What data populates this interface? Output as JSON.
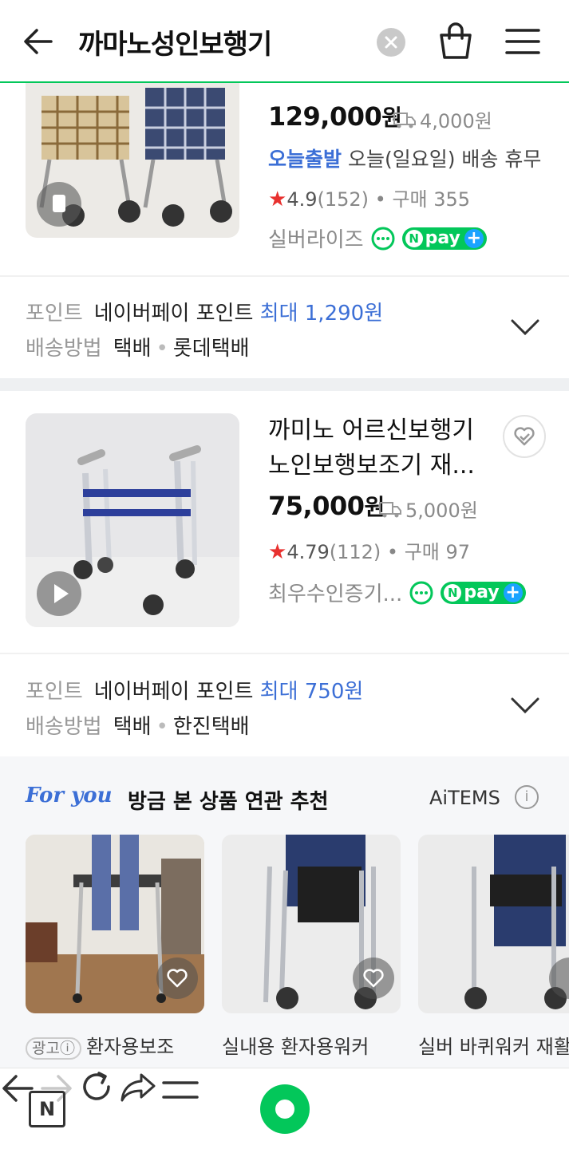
{
  "header": {
    "title": "까마노성인보행기"
  },
  "product1": {
    "price": "129,000",
    "currency": "원",
    "shipping_fee": "4,000원",
    "today_badge": "오늘출발",
    "today_note": "오늘(일요일) 배송 휴무",
    "rating": "4.9",
    "review_count": "(152)",
    "purchase": "구매 355",
    "seller": "실버라이즈",
    "npay": "pay",
    "points_label": "포인트",
    "points_text": "네이버페이 포인트",
    "points_value": "최대 1,290원",
    "delivery_label": "배송방법",
    "delivery_method": "택배",
    "courier": "롯데택배"
  },
  "product2": {
    "title_line1": "까미노 어르신보행기",
    "title_line2": "노인보행보조기 재...",
    "price": "75,000",
    "currency": "원",
    "shipping_fee": "5,000원",
    "rating": "4.79",
    "review_count": "(112)",
    "purchase": "구매 97",
    "seller": "최우수인증기...",
    "npay": "pay",
    "points_label": "포인트",
    "points_text": "네이버페이 포인트",
    "points_value": "최대 750원",
    "delivery_label": "배송방법",
    "delivery_method": "택배",
    "courier": "한진택배"
  },
  "recommend": {
    "foryou": "For you",
    "title": "방금 본 상품 연관 추천",
    "brand": "AiTEMS",
    "items": [
      {
        "ad": "광고ⓘ",
        "label": "환자용보조"
      },
      {
        "label": "실내용 환자용워커"
      },
      {
        "label": "실버 바퀴워커 재활"
      }
    ]
  },
  "colors": {
    "accent_green": "#03c75a",
    "link_blue": "#3c6fd6",
    "star_red": "#e8312f"
  },
  "icons": [
    "back-arrow-icon",
    "clear-icon",
    "shopping-bag-icon",
    "menu-icon",
    "play-icon",
    "heart-icon",
    "chat-icon",
    "truck-icon",
    "chevron-down-icon",
    "naver-n-icon",
    "forward-arrow-icon",
    "reload-icon",
    "share-icon"
  ]
}
